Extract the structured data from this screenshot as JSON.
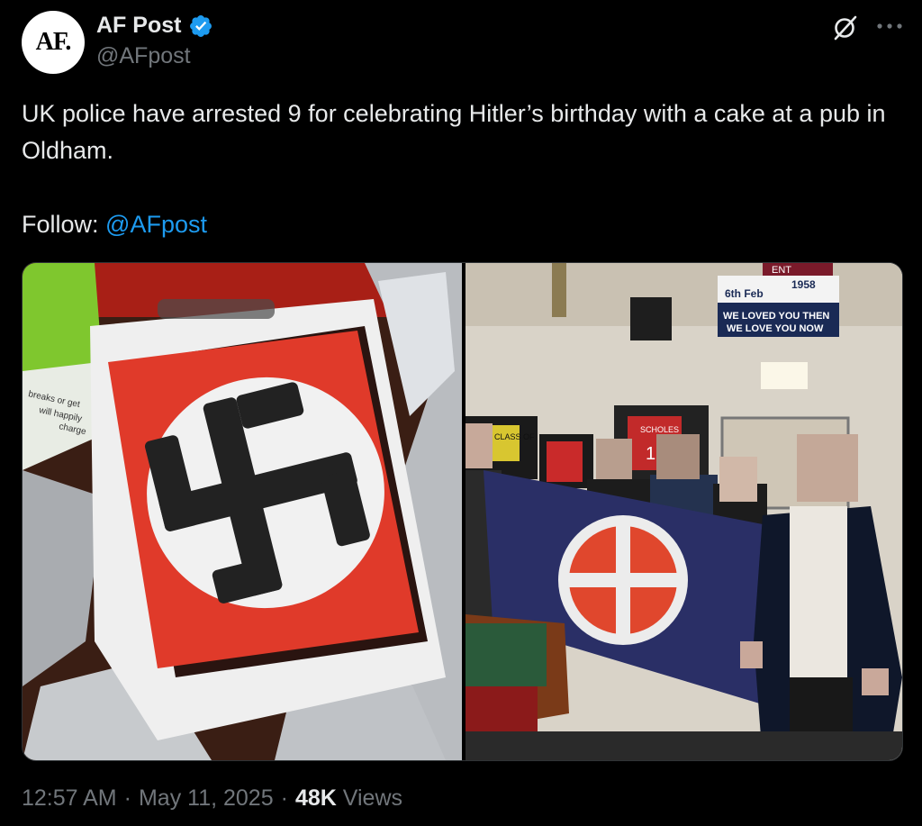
{
  "author": {
    "avatar_text": "AF.",
    "name": "AF Post",
    "handle": "@AFpost",
    "verified_color": "#1d9bf0"
  },
  "post": {
    "text": "UK police have arrested 9 for celebrating Hitler’s birthday with a cake at a pub in Oldham.",
    "follow_prefix": "Follow: ",
    "follow_mention": "@AFpost"
  },
  "media": {
    "banner_line1": "6th Feb",
    "banner_line2": "1958",
    "banner_line3": "WE LOVED YOU THEN",
    "banner_line4": "WE LOVE YOU NOW",
    "banner_top": "ENT",
    "shirt_name": "SCHOLES",
    "shirt_number": "18",
    "frame_text": "CLASS OF",
    "bag_text_1": "breaks or get",
    "bag_text_2": "will happily",
    "bag_text_3": "charge"
  },
  "meta": {
    "time": "12:57 AM",
    "separator": "·",
    "date": "May 11, 2025",
    "views_count": "48K",
    "views_label": "Views"
  },
  "icons": {
    "grok": "grok-icon",
    "more": "more-dots-icon",
    "verified": "verified-badge-icon"
  },
  "colors": {
    "background": "#000000",
    "text_primary": "#e7e9ea",
    "text_secondary": "#71767b",
    "accent": "#1d9bf0"
  }
}
